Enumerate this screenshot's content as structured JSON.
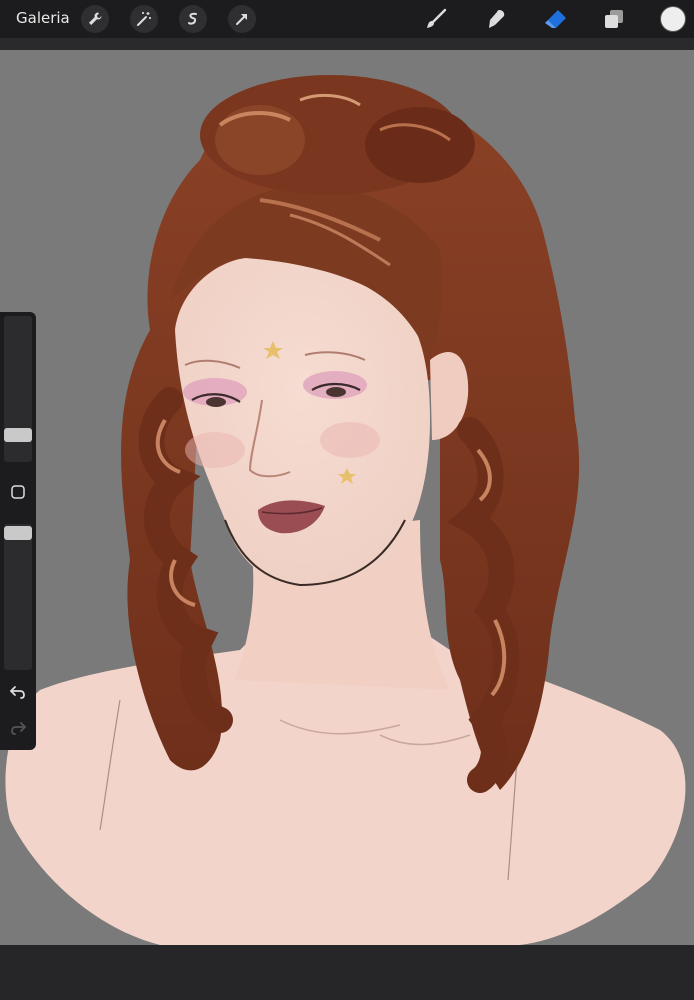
{
  "app": {
    "gallery_label": "Galeria"
  },
  "toolbar": {
    "left_icons": [
      "wrench-icon",
      "magic-wand-icon",
      "selection-icon",
      "arrow-transform-icon"
    ],
    "right_tools": [
      "brush-icon",
      "smudge-icon",
      "eraser-icon",
      "layers-icon"
    ],
    "active_tool": "eraser-icon",
    "active_color": "#1f6fe0",
    "current_color": "#eeeeee"
  },
  "sidebar": {
    "brush_size_level": 0.78,
    "opacity_level": 0.02,
    "icons": [
      "modify-square-icon",
      "undo-icon",
      "redo-icon"
    ]
  },
  "canvas": {
    "background": "#7a7a7a"
  }
}
